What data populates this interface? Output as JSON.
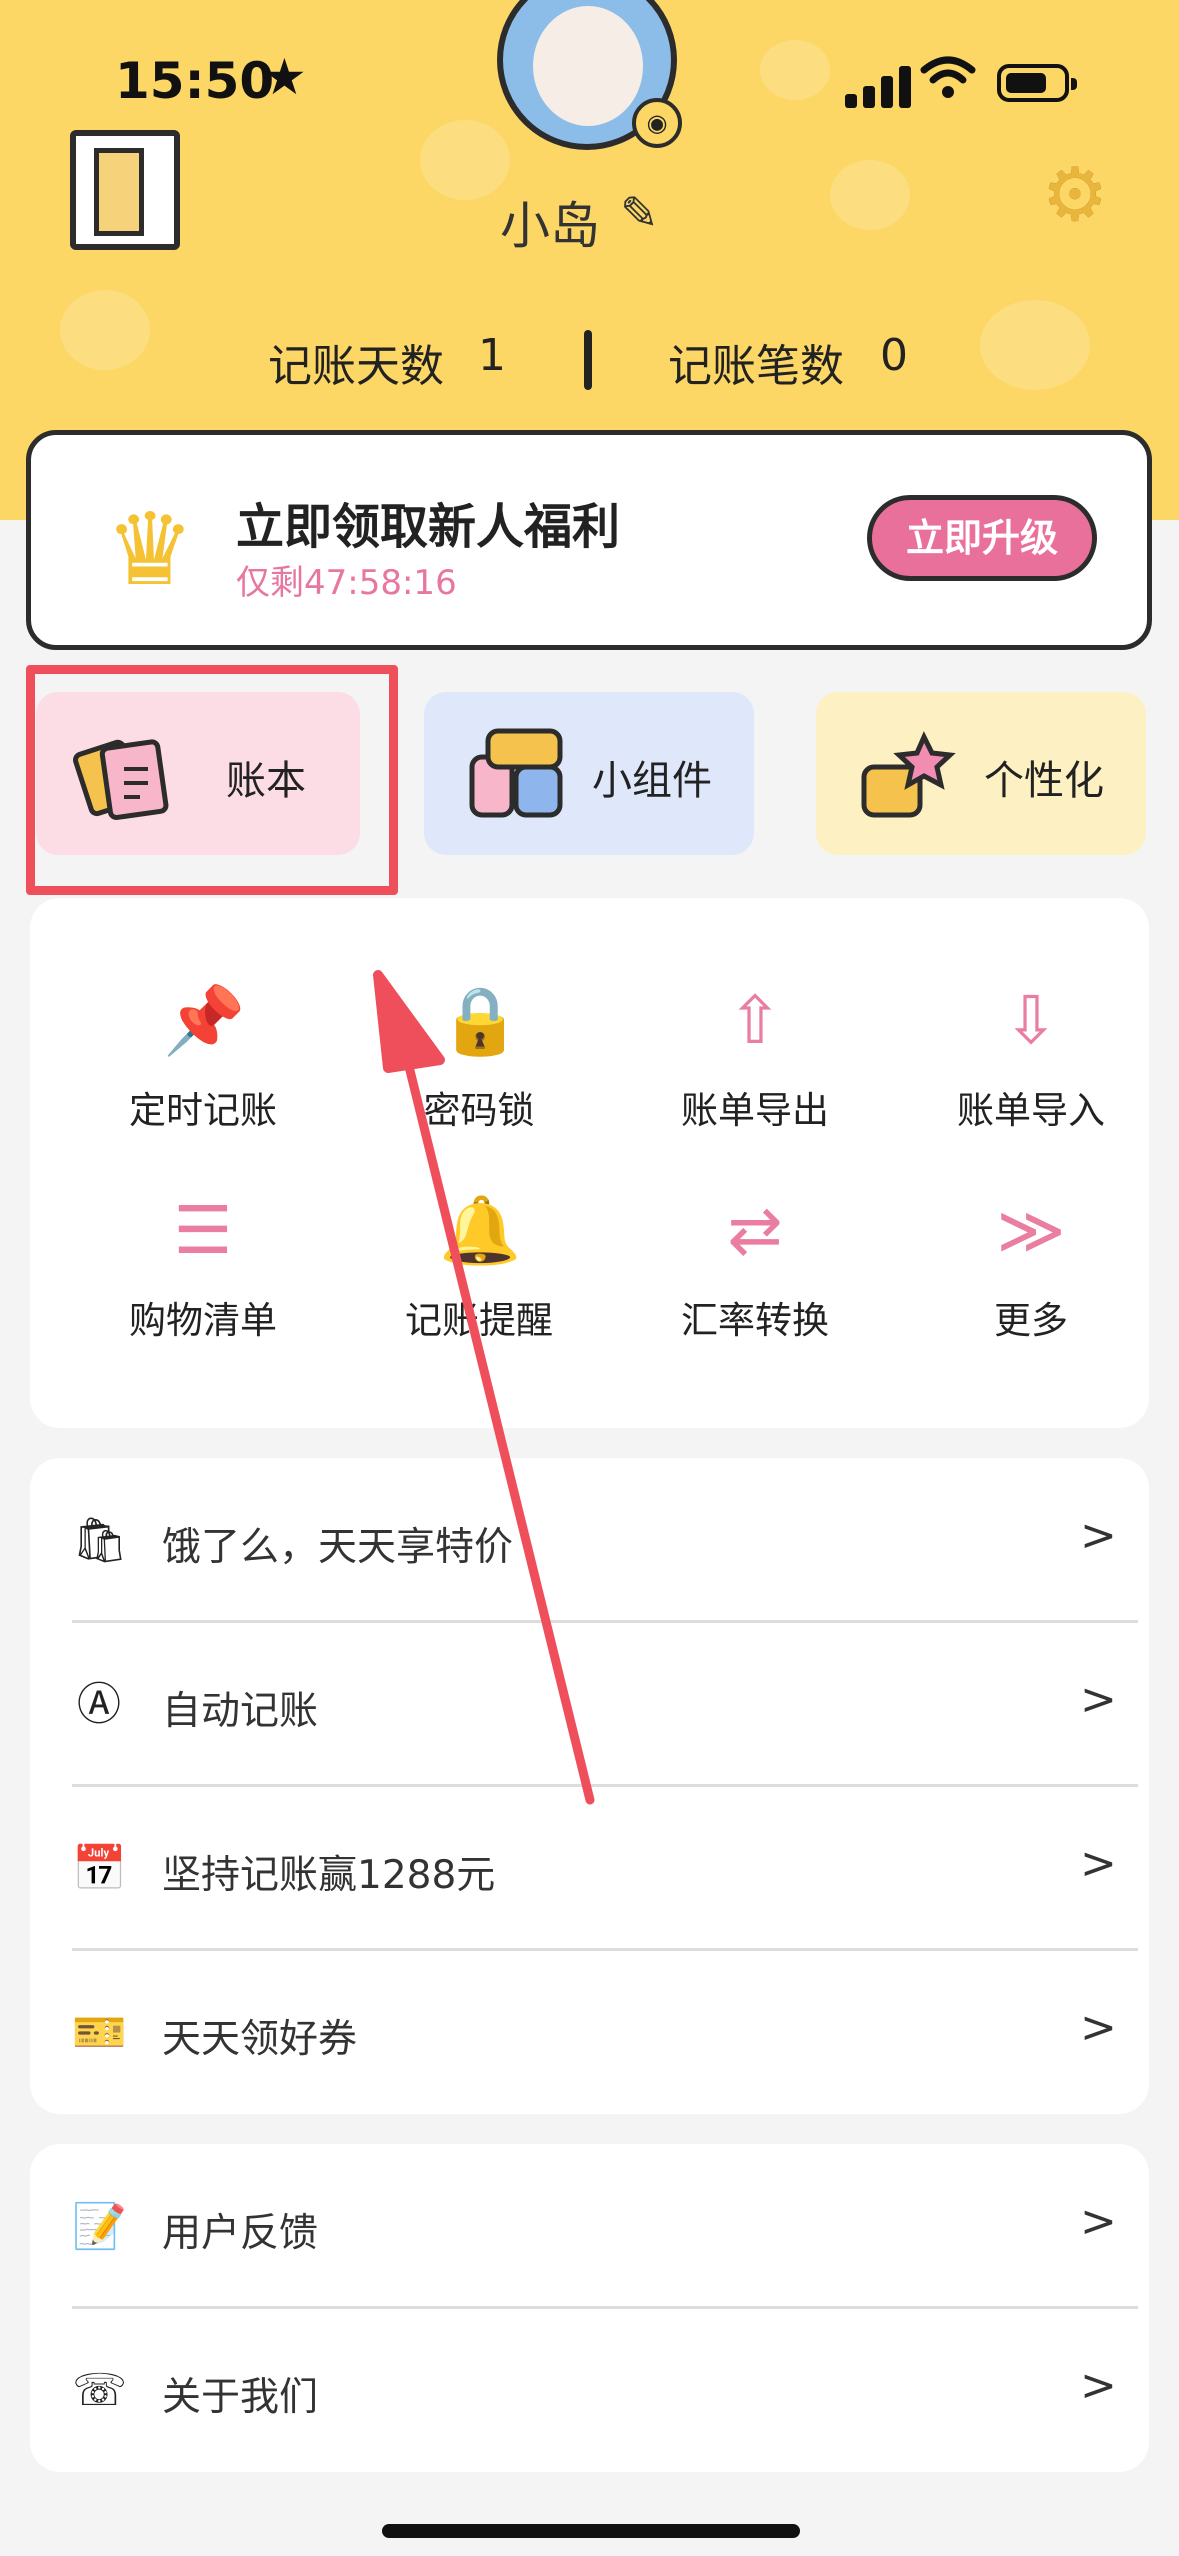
{
  "status_bar": {
    "time": "15:50",
    "star": "★",
    "wifi": "wifi",
    "battery_level": 0.6
  },
  "header": {
    "username": "小岛",
    "edit_glyph": "✎",
    "gear_glyph": "⚙",
    "camera_glyph": "◉",
    "stats": [
      {
        "label": "记账天数",
        "value": "1"
      },
      {
        "label": "记账笔数",
        "value": "0"
      }
    ]
  },
  "promo": {
    "title": "立即领取新人福利",
    "countdown": "仅剩47:58:16",
    "button": "立即升级",
    "crown_glyph": "♛"
  },
  "tiles": [
    {
      "label": "账本",
      "icon": "ledger-icon",
      "bg": "#fcdde6"
    },
    {
      "label": "小组件",
      "icon": "widget-icon",
      "bg": "#dfe7fb"
    },
    {
      "label": "个性化",
      "icon": "personalize-icon",
      "bg": "#fdf0c2"
    }
  ],
  "grid": [
    {
      "label": "定时记账",
      "icon": "pushpin-icon",
      "glyph": "📌"
    },
    {
      "label": "密码锁",
      "icon": "lock-icon",
      "glyph": "🔒"
    },
    {
      "label": "账单导出",
      "icon": "export-icon",
      "glyph": "⇧"
    },
    {
      "label": "账单导入",
      "icon": "import-icon",
      "glyph": "⇩"
    },
    {
      "label": "购物清单",
      "icon": "clipboard-icon",
      "glyph": "☰"
    },
    {
      "label": "记账提醒",
      "icon": "bell-icon",
      "glyph": "🔔"
    },
    {
      "label": "汇率转换",
      "icon": "exchange-icon",
      "glyph": "⇄"
    },
    {
      "label": "更多",
      "icon": "more-chevron-icon",
      "glyph": "≫"
    }
  ],
  "list1": [
    {
      "label": "饿了么，天天享特价",
      "icon": "coupon-bag-icon",
      "glyph": "🛍"
    },
    {
      "label": "自动记账",
      "icon": "auto-a-icon",
      "glyph": "Ⓐ"
    },
    {
      "label": "坚持记账赢1288元",
      "icon": "calendar-365-icon",
      "glyph": "📅"
    },
    {
      "label": "天天领好券",
      "icon": "ticket-icon",
      "glyph": "🎫"
    }
  ],
  "list2": [
    {
      "label": "用户反馈",
      "icon": "feedback-icon",
      "glyph": "📝"
    },
    {
      "label": "关于我们",
      "icon": "phone-chat-icon",
      "glyph": "☏"
    }
  ],
  "chevron": ">",
  "colors": {
    "header": "#fcd766",
    "accent_pink": "#e9709a",
    "annotation_red": "#ef4f5b"
  }
}
